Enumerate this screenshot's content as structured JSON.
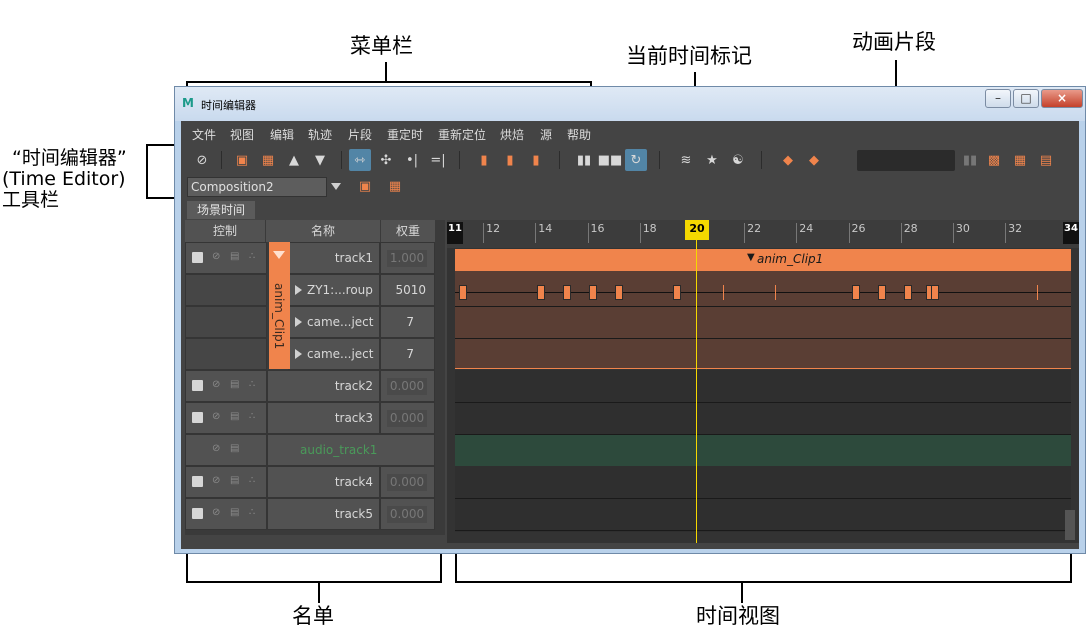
{
  "annotations": {
    "menubar": "菜单栏",
    "current_time": "当前时间标记",
    "anim_clip": "动画片段",
    "toolbar_line1": "“时间编辑器”",
    "toolbar_line2": "(Time Editor)",
    "toolbar_line3": "工具栏",
    "outliner": "名单",
    "time_view": "时间视图"
  },
  "window": {
    "title": "时间编辑器",
    "icon": "maya-m-icon"
  },
  "menu": [
    "文件",
    "视图",
    "编辑",
    "轨迹",
    "片段",
    "重定时",
    "重新定位",
    "烘焙",
    "源",
    "帮助"
  ],
  "toolbar": {
    "composition": "Composition2",
    "tab": "场景时间"
  },
  "outliner": {
    "headers": {
      "control": "控制",
      "name": "名称",
      "weight": "权重"
    },
    "clip_label": "anim_Clip1",
    "rows": [
      {
        "name": "track1",
        "weight": "1.000"
      },
      {
        "name": "ZY1:...roup",
        "weight": "5010"
      },
      {
        "name": "came...ject",
        "weight": "7"
      },
      {
        "name": "came...ject",
        "weight": "7"
      },
      {
        "name": "track2",
        "weight": "0.000"
      },
      {
        "name": "track3",
        "weight": "0.000"
      },
      {
        "name": "audio_track1",
        "weight": ""
      },
      {
        "name": "track4",
        "weight": "0.000"
      },
      {
        "name": "track5",
        "weight": "0.000"
      }
    ]
  },
  "timeline": {
    "start": "11",
    "end": "34",
    "ticks": [
      "12",
      "14",
      "16",
      "18",
      "20",
      "22",
      "24",
      "26",
      "28",
      "30",
      "32"
    ],
    "current_frame": "20",
    "clip_name": "anim_Clip1"
  },
  "colors": {
    "clip": "#f0844c",
    "playhead": "#f5d800",
    "audio": "#4a9a5a"
  }
}
